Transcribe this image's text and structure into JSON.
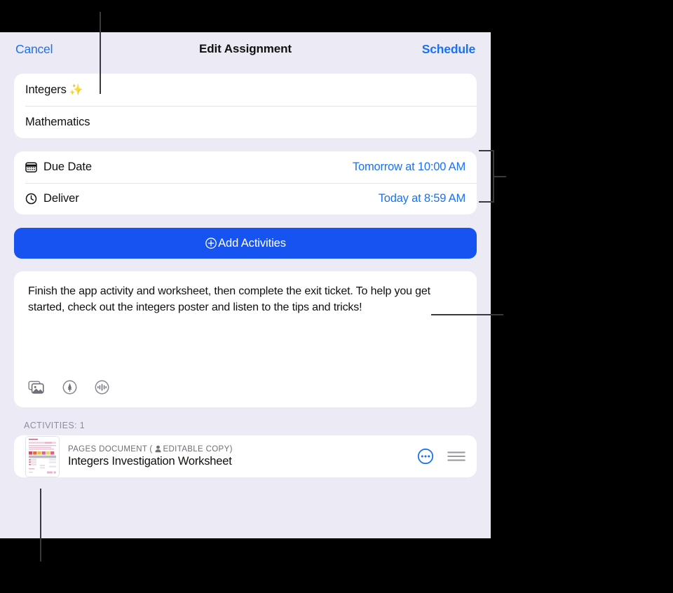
{
  "window": {
    "background_color": "#000000",
    "panel_background": "#eceaf5",
    "accent_blue": "#1a72f2",
    "button_blue": "#1753f0"
  },
  "navbar": {
    "cancel_label": "Cancel",
    "title": "Edit Assignment",
    "schedule_label": "Schedule"
  },
  "title_card": {
    "assignment_title": "Integers",
    "assignment_title_emoji": "✨",
    "class_name": "Mathematics"
  },
  "dates_card": {
    "rows": [
      {
        "icon": "calendar-icon",
        "label": "Due Date",
        "value": "Tomorrow at 10:00 AM"
      },
      {
        "icon": "clock-icon",
        "label": "Deliver",
        "value": "Today at 8:59 AM"
      }
    ]
  },
  "add_activities_button": {
    "icon": "plus-circle-icon",
    "label": "Add Activities"
  },
  "description": {
    "text": "Finish the app activity and worksheet, then complete the exit ticket. To help you get started, check out the integers poster and listen to the tips and tricks!",
    "toolbar_icons": [
      "photos-icon",
      "markup-pen-icon",
      "audio-recording-icon"
    ]
  },
  "activities": {
    "section_label": "ACTIVITIES: 1",
    "items": [
      {
        "thumbnail": "pages-document-thumbnail",
        "kind": "PAGES DOCUMENT",
        "copy_badge_icon": "person-icon",
        "copy_badge": "( EDITABLE COPY)",
        "copy_badge_text": "EDITABLE COPY)",
        "title": "Integers Investigation Worksheet",
        "more_icon": "more-circle-icon",
        "reorder_icon": "reorder-handle-icon"
      }
    ]
  },
  "annotations": {
    "line_color": "#3a3a3c",
    "callouts": [
      "title-field-callout",
      "dates-bracket-callout",
      "description-callout",
      "activity-thumbnail-callout"
    ]
  }
}
